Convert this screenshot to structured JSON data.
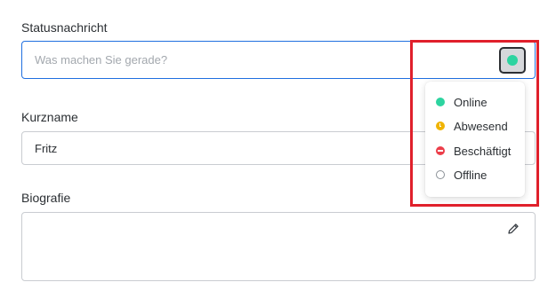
{
  "status": {
    "label": "Statusnachricht",
    "placeholder": "Was machen Sie gerade?",
    "current_status_color": "#2dd4a0",
    "current_status": "Online"
  },
  "status_menu": {
    "items": [
      {
        "label": "Online",
        "icon": "green-dot-icon",
        "color": "#2dd4a0"
      },
      {
        "label": "Abwesend",
        "icon": "clock-icon",
        "color": "#f0b400"
      },
      {
        "label": "Beschäftigt",
        "icon": "minus-circle-icon",
        "color": "#ec3e4a"
      },
      {
        "label": "Offline",
        "icon": "empty-circle-icon",
        "color": "#8a9096"
      }
    ]
  },
  "nickname": {
    "label": "Kurzname",
    "value": "Fritz"
  },
  "bio": {
    "label": "Biografie",
    "value": ""
  },
  "colors": {
    "focus": "#1f6fe0",
    "highlight": "#e0202b"
  }
}
